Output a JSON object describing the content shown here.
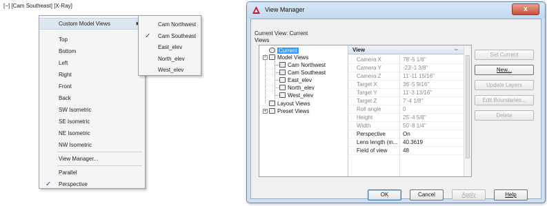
{
  "viewport_label": {
    "part1": "[−]",
    "part2": "[Cam Southeast]",
    "part3": "[X-Ray]"
  },
  "context_menu": {
    "items": [
      {
        "label": "Custom Model Views",
        "has_submenu": true,
        "checked": false
      },
      {
        "label": "Top"
      },
      {
        "label": "Bottom"
      },
      {
        "label": "Left"
      },
      {
        "label": "Right"
      },
      {
        "label": "Front"
      },
      {
        "label": "Back"
      },
      {
        "label": "SW Isometric"
      },
      {
        "label": "SE Isometric"
      },
      {
        "label": "NE Isometric"
      },
      {
        "label": "NW Isometric"
      },
      {
        "label": "View Manager..."
      },
      {
        "label": "Parallel"
      },
      {
        "label": "Perspective",
        "checked": true
      }
    ],
    "check_glyph": "✓",
    "arrow_glyph": "▶"
  },
  "submenu": {
    "items": [
      {
        "label": "Cam Northwest"
      },
      {
        "label": "Cam Southeast",
        "checked": true
      },
      {
        "label": "East_elev"
      },
      {
        "label": "North_elev"
      },
      {
        "label": "West_elev"
      }
    ]
  },
  "dialog": {
    "title": "View Manager",
    "close_glyph": "x",
    "current_view": "Current View: Current",
    "views_label": "Views",
    "tree": {
      "current": "Current",
      "model_views": "Model Views",
      "children": [
        "Cam Northwest",
        "Cam Southeast",
        "East_elev",
        "North_elev",
        "West_elev"
      ],
      "layout_views": "Layout Views",
      "preset_views": "Preset Views",
      "minus": "−",
      "plus": "+"
    },
    "props": {
      "header": "View",
      "collapse_glyph": "−",
      "rows": [
        {
          "key": "Camera X",
          "value": "78'-5 1/8\"",
          "readonly": true
        },
        {
          "key": "Camera Y",
          "value": "-23'-1 3/8\"",
          "readonly": true
        },
        {
          "key": "Camera Z",
          "value": "11'-11 15/16\"",
          "readonly": true
        },
        {
          "key": "Target X",
          "value": "36'-5 9/16\"",
          "readonly": true
        },
        {
          "key": "Target Y",
          "value": "11'-3 13/16\"",
          "readonly": true
        },
        {
          "key": "Target Z",
          "value": "7'-4 1/8\"",
          "readonly": true
        },
        {
          "key": "Roll angle",
          "value": "0",
          "readonly": true
        },
        {
          "key": "Height",
          "value": "25'-4 5/8\"",
          "readonly": true
        },
        {
          "key": "Width",
          "value": "50'-8 1/4\"",
          "readonly": true
        },
        {
          "key": "Perspective",
          "value": "On",
          "readonly": false
        },
        {
          "key": "Lens length (m...",
          "value": "40.3619",
          "readonly": false
        },
        {
          "key": "Field of view",
          "value": "48",
          "readonly": false
        }
      ]
    },
    "side_buttons": [
      {
        "label": "Set Current",
        "enabled": false
      },
      {
        "label": "New...",
        "enabled": true
      },
      {
        "label": "Update Layers",
        "enabled": false
      },
      {
        "label": "Edit Boundaries...",
        "enabled": false
      },
      {
        "label": "Delete",
        "enabled": false
      }
    ],
    "bottom_buttons": [
      {
        "label": "OK",
        "enabled": true
      },
      {
        "label": "Cancel",
        "enabled": true
      },
      {
        "label": "Apply",
        "enabled": false
      },
      {
        "label": "Help",
        "enabled": true
      }
    ]
  },
  "colors": {
    "menu_bg": "#f5f5f5",
    "menu_highlight": "#dde7f2",
    "dialog_frame": "#cfe0f3",
    "selection_blue": "#3399ff",
    "close_red": "#c9503a"
  }
}
